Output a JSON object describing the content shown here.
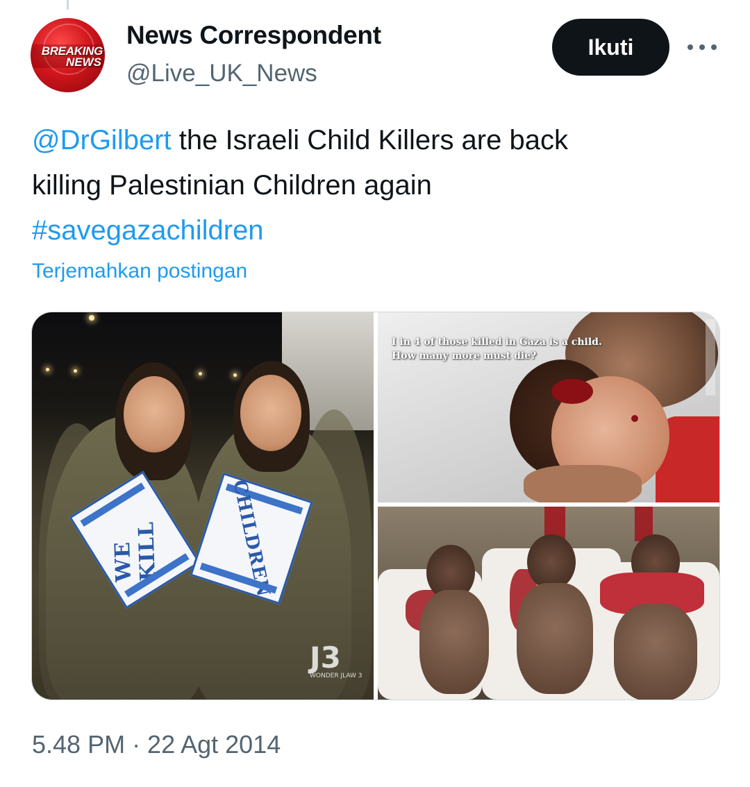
{
  "author": {
    "display_name": "News Correspondent",
    "handle": "@Live_UK_News",
    "avatar_text_line1": "BREAKING",
    "avatar_text_line2": "NEWS"
  },
  "actions": {
    "follow_label": "Ikuti",
    "more_icon": "more-horizontal-icon"
  },
  "tweet": {
    "mention": "@DrGilbert",
    "text_line1": " the Israeli Child Killers are back",
    "text_line2": "killing Palestinian Children again",
    "hashtag": "#savegazachildren",
    "translate_label": "Terjemahkan postingan",
    "timestamp": "5.48 PM · 22 Agt 2014"
  },
  "media": {
    "left_sign_1": "WE KILL",
    "left_sign_2": "CHILDREN",
    "watermark": "J3",
    "watermark_sub": "WONDER JLAW 3",
    "top_right_caption_line1": "I in 4 of those killed in Gaza is a child.",
    "top_right_caption_line2": "How many more must die?"
  },
  "colors": {
    "link": "#1d9bf0",
    "text": "#0f1419",
    "secondary": "#536471",
    "follow_button_bg": "#0f1419"
  }
}
